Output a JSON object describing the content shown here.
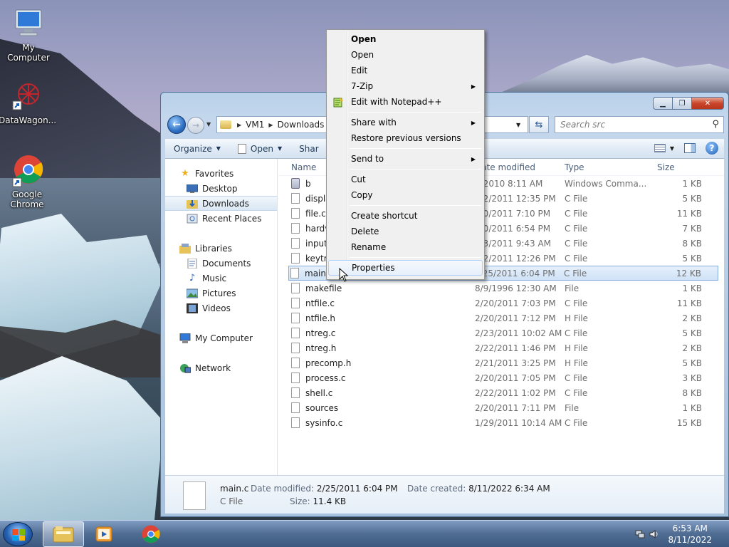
{
  "desktop": {
    "icons": [
      {
        "label": "My Computer",
        "icon": "computer-icon"
      },
      {
        "label": "DataWagon...",
        "icon": "datawagon-icon"
      },
      {
        "label": "Google Chrome",
        "icon": "chrome-icon"
      }
    ]
  },
  "window": {
    "address": {
      "parts": [
        "VM1",
        "Downloads"
      ]
    },
    "search_placeholder": "Search src",
    "toolbar": {
      "organize": "Organize",
      "open": "Open",
      "share": "Shar"
    },
    "nav": {
      "favorites": "Favorites",
      "desktop": "Desktop",
      "downloads": "Downloads",
      "recent": "Recent Places",
      "libraries": "Libraries",
      "documents": "Documents",
      "music": "Music",
      "pictures": "Pictures",
      "videos": "Videos",
      "computer": "My Computer",
      "network": "Network"
    },
    "columns": {
      "name": "Name",
      "date": "Date modified",
      "type": "Type",
      "size": "Size"
    },
    "files": [
      {
        "name": "b",
        "date": "4/2010 8:11 AM",
        "type": "Windows Comma...",
        "size": "1 KB"
      },
      {
        "name": "displa",
        "date": "/22/2011 12:35 PM",
        "type": "C File",
        "size": "5 KB"
      },
      {
        "name": "file.c",
        "date": "/20/2011 7:10 PM",
        "type": "C File",
        "size": "11 KB"
      },
      {
        "name": "hardv",
        "date": "/20/2011 6:54 PM",
        "type": "C File",
        "size": "7 KB"
      },
      {
        "name": "input",
        "date": "/23/2011 9:43 AM",
        "type": "C File",
        "size": "8 KB"
      },
      {
        "name": "keytra",
        "date": "/22/2011 12:26 PM",
        "type": "C File",
        "size": "5 KB"
      },
      {
        "name": "main.c",
        "date": "2/25/2011 6:04 PM",
        "type": "C File",
        "size": "12 KB"
      },
      {
        "name": "makefile",
        "date": "8/9/1996 12:30 AM",
        "type": "File",
        "size": "1 KB"
      },
      {
        "name": "ntfile.c",
        "date": "2/20/2011 7:03 PM",
        "type": "C File",
        "size": "11 KB"
      },
      {
        "name": "ntfile.h",
        "date": "2/20/2011 7:12 PM",
        "type": "H File",
        "size": "2 KB"
      },
      {
        "name": "ntreg.c",
        "date": "2/23/2011 10:02 AM",
        "type": "C File",
        "size": "5 KB"
      },
      {
        "name": "ntreg.h",
        "date": "2/22/2011 1:46 PM",
        "type": "H File",
        "size": "2 KB"
      },
      {
        "name": "precomp.h",
        "date": "2/21/2011 3:25 PM",
        "type": "H File",
        "size": "5 KB"
      },
      {
        "name": "process.c",
        "date": "2/20/2011 7:05 PM",
        "type": "C File",
        "size": "3 KB"
      },
      {
        "name": "shell.c",
        "date": "2/22/2011 1:02 PM",
        "type": "C File",
        "size": "8 KB"
      },
      {
        "name": "sources",
        "date": "2/20/2011 7:11 PM",
        "type": "File",
        "size": "1 KB"
      },
      {
        "name": "sysinfo.c",
        "date": "1/29/2011 10:14 AM",
        "type": "C File",
        "size": "15 KB"
      }
    ],
    "details": {
      "name": "main.c",
      "type": "C File",
      "modified_label": "Date modified:",
      "modified": "2/25/2011 6:04 PM",
      "size_label": "Size:",
      "size": "11.4 KB",
      "created_label": "Date created:",
      "created": "8/11/2022 6:34 AM"
    }
  },
  "context_menu": {
    "items": [
      "Open",
      "Open",
      "Edit",
      "7-Zip",
      "Edit with Notepad++",
      "Share with",
      "Restore previous versions",
      "Send to",
      "Cut",
      "Copy",
      "Create shortcut",
      "Delete",
      "Rename",
      "Properties"
    ]
  },
  "taskbar": {
    "time": "6:53 AM",
    "date": "8/11/2022"
  }
}
